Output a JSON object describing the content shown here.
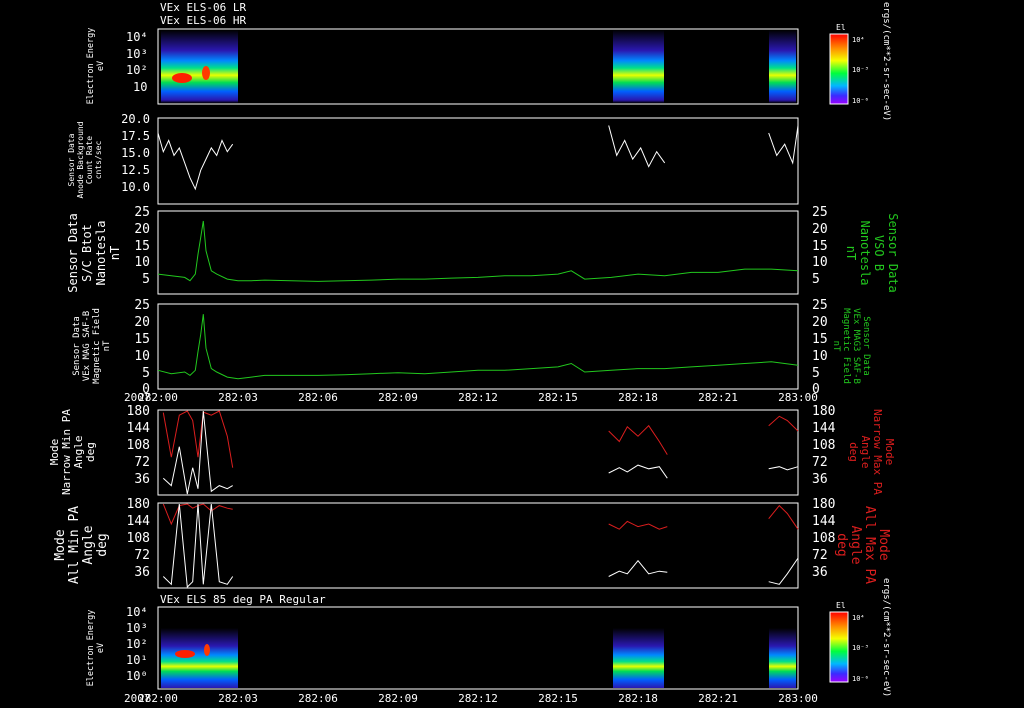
{
  "titles": {
    "top_line1": "VEx ELS-06 LR",
    "top_line2": "VEx ELS-06 HR",
    "bottom": "VEx ELS 85 deg PA Regular"
  },
  "colorbar": {
    "label": "El",
    "ticks": [
      "10⁴",
      "10⁻³",
      "10⁻⁶"
    ],
    "units": "ergs/(cm**2-sr-sec-eV)"
  },
  "time_axis": {
    "year": "2007",
    "ticks": [
      "282:00",
      "282:03",
      "282:06",
      "282:09",
      "282:12",
      "282:15",
      "282:18",
      "282:21",
      "283:00"
    ]
  },
  "colors": {
    "white_series": "#ffffff",
    "green_series": "#22c81e",
    "red_series": "#dc1e1e"
  },
  "chart_data": [
    {
      "type": "heatmap",
      "ylabel": [
        "Electron Energy",
        "eV"
      ],
      "yscale": "log",
      "ytick_labels": [
        "10⁴",
        "10³",
        "10²",
        "10"
      ],
      "data_intervals": [
        [
          "282:00",
          "282:02.9"
        ],
        [
          "282:16.9",
          "282:19.1"
        ],
        [
          "282:22.9",
          "282:24"
        ]
      ]
    },
    {
      "type": "line",
      "ylabel": [
        "Sensor Data",
        "Anode Background",
        "Count Rate",
        "cnts/sec"
      ],
      "ylim": [
        8.5,
        20
      ],
      "yticks": [
        "20.0",
        "17.5",
        "15.0",
        "12.5",
        "10.0"
      ],
      "series": [
        {
          "color": "#ffffff",
          "segment": 1,
          "x": [
            0,
            0.2,
            0.4,
            0.6,
            0.8,
            1.0,
            1.2,
            1.4,
            1.6,
            1.8,
            2.0,
            2.2,
            2.4,
            2.6,
            2.8
          ],
          "y": [
            18,
            15.5,
            17,
            15,
            16,
            14,
            12,
            10.5,
            13,
            14.5,
            16,
            15,
            17,
            15.5,
            16.5
          ]
        },
        {
          "color": "#ffffff",
          "segment": 2,
          "x": [
            16.9,
            17.2,
            17.5,
            17.8,
            18.1,
            18.4,
            18.7,
            19.0
          ],
          "y": [
            19,
            15,
            17,
            14.5,
            16,
            13.5,
            15.5,
            14
          ]
        },
        {
          "color": "#ffffff",
          "segment": 3,
          "x": [
            22.9,
            23.2,
            23.5,
            23.8,
            24.0
          ],
          "y": [
            18,
            15,
            16.5,
            14,
            19
          ]
        }
      ]
    },
    {
      "type": "line",
      "ylabel": [
        "Sensor Data",
        "S/C Btot",
        "Nanotesla",
        "nT"
      ],
      "ylabel_right": [
        "Sensor Data",
        "VSO B",
        "Nanotesla",
        "nT"
      ],
      "ylim": [
        0,
        25
      ],
      "yticks": [
        "25",
        "20",
        "15",
        "10",
        "5"
      ],
      "series": [
        {
          "color": "#22c81e",
          "x": [
            0,
            0.5,
            1.0,
            1.2,
            1.4,
            1.5,
            1.6,
            1.7,
            1.8,
            2.0,
            2.2,
            2.6,
            3.0,
            3.5,
            4,
            5,
            6,
            7,
            8,
            9,
            10,
            11,
            12,
            13,
            14,
            15,
            15.5,
            16,
            17,
            18,
            19,
            20,
            21,
            22,
            23,
            24
          ],
          "y": [
            6,
            5.5,
            5,
            4,
            6,
            12,
            17,
            22,
            13,
            7,
            6,
            4.5,
            4,
            4,
            4.2,
            4,
            3.8,
            4,
            4.2,
            4.5,
            4.5,
            4.8,
            5,
            5.5,
            5.5,
            6,
            7,
            4.5,
            5,
            6,
            5.5,
            6.5,
            6.5,
            7.5,
            7.5,
            7
          ]
        }
      ]
    },
    {
      "type": "line",
      "ylabel": [
        "Sensor Data",
        "VEx MAG SAF-B",
        "Magnetic Field",
        "nT"
      ],
      "ylabel_right": [
        "Sensor Data",
        "VEx MAG3 SAF-B",
        "Magnetic Field",
        "nT"
      ],
      "ylim": [
        0,
        25
      ],
      "yticks": [
        "25",
        "20",
        "15",
        "10",
        "5",
        "0"
      ],
      "series": [
        {
          "color": "#22c81e",
          "x": [
            0,
            0.5,
            1.0,
            1.2,
            1.4,
            1.5,
            1.6,
            1.7,
            1.8,
            2.0,
            2.2,
            2.6,
            3.0,
            3.5,
            4,
            5,
            6,
            7,
            8,
            9,
            10,
            11,
            12,
            13,
            14,
            15,
            15.5,
            16,
            17,
            18,
            19,
            20,
            21,
            22,
            23,
            24
          ],
          "y": [
            5.5,
            4.5,
            5,
            4,
            5.5,
            11,
            16,
            22,
            12,
            6,
            5,
            3.5,
            3,
            3.5,
            4,
            4,
            4,
            4.2,
            4.5,
            4.8,
            4.5,
            5,
            5.5,
            5.5,
            6,
            6.5,
            7.5,
            5,
            5.5,
            6,
            6,
            6.5,
            7,
            7.5,
            8,
            7
          ]
        }
      ]
    },
    {
      "type": "line",
      "ylabel": [
        "Mode",
        "Narrow Min PA",
        "Angle",
        "deg"
      ],
      "ylabel_right": [
        "Mode",
        "Narrow Max PA",
        "Angle",
        "deg"
      ],
      "ylim": [
        18,
        180
      ],
      "yticks": [
        "180",
        "144",
        "108",
        "72",
        "36"
      ],
      "series": [
        {
          "color": "#dc1e1e",
          "x": [
            0.2,
            0.5,
            0.8,
            1.1,
            1.3,
            1.5,
            1.7,
            2.0,
            2.3,
            2.6,
            2.8
          ],
          "y": [
            175,
            90,
            170,
            178,
            160,
            90,
            176,
            170,
            178,
            130,
            70
          ]
        },
        {
          "color": "#dc1e1e",
          "x": [
            16.9,
            17.3,
            17.6,
            18.0,
            18.4,
            18.8,
            19.1
          ],
          "y": [
            140,
            120,
            148,
            130,
            150,
            120,
            95
          ]
        },
        {
          "color": "#dc1e1e",
          "x": [
            22.9,
            23.3,
            23.6,
            24.0
          ],
          "y": [
            150,
            168,
            160,
            140
          ]
        },
        {
          "color": "#ffffff",
          "x": [
            0.2,
            0.5,
            0.8,
            1.1,
            1.3,
            1.5,
            1.7,
            2.0,
            2.3,
            2.6,
            2.8
          ],
          "y": [
            50,
            36,
            110,
            20,
            70,
            30,
            178,
            25,
            36,
            30,
            36
          ]
        },
        {
          "color": "#ffffff",
          "x": [
            16.9,
            17.3,
            17.6,
            18.0,
            18.4,
            18.8,
            19.1
          ],
          "y": [
            60,
            70,
            62,
            75,
            68,
            72,
            50
          ]
        },
        {
          "color": "#ffffff",
          "x": [
            22.9,
            23.3,
            23.6,
            24.0
          ],
          "y": [
            68,
            72,
            66,
            72
          ]
        }
      ]
    },
    {
      "type": "line",
      "ylabel": [
        "Mode",
        "All Min PA",
        "Angle",
        "deg"
      ],
      "ylabel_right": [
        "Mode",
        "All Max PA",
        "Angle",
        "deg"
      ],
      "ylim": [
        18,
        180
      ],
      "yticks": [
        "180",
        "144",
        "108",
        "72",
        "36"
      ],
      "series": [
        {
          "color": "#dc1e1e",
          "x": [
            0.2,
            0.5,
            0.8,
            1.1,
            1.3,
            1.5,
            1.7,
            2.0,
            2.3,
            2.6,
            2.8
          ],
          "y": [
            178,
            140,
            175,
            178,
            170,
            175,
            178,
            165,
            175,
            170,
            168
          ]
        },
        {
          "color": "#dc1e1e",
          "x": [
            16.9,
            17.3,
            17.6,
            18.0,
            18.4,
            18.8,
            19.1
          ],
          "y": [
            140,
            130,
            145,
            135,
            140,
            130,
            135
          ]
        },
        {
          "color": "#dc1e1e",
          "x": [
            22.9,
            23.3,
            23.6,
            24.0
          ],
          "y": [
            150,
            175,
            160,
            130
          ]
        },
        {
          "color": "#ffffff",
          "x": [
            0.2,
            0.5,
            0.8,
            1.1,
            1.3,
            1.5,
            1.7,
            2.0,
            2.3,
            2.6,
            2.8
          ],
          "y": [
            40,
            25,
            178,
            20,
            30,
            178,
            25,
            178,
            30,
            25,
            40
          ]
        },
        {
          "color": "#ffffff",
          "x": [
            16.9,
            17.3,
            17.6,
            18.0,
            18.4,
            18.8,
            19.1
          ],
          "y": [
            40,
            50,
            45,
            70,
            45,
            50,
            48
          ]
        },
        {
          "color": "#ffffff",
          "x": [
            22.9,
            23.3,
            23.6,
            24.0
          ],
          "y": [
            30,
            25,
            45,
            75
          ]
        }
      ]
    },
    {
      "type": "heatmap",
      "ylabel": [
        "Electron Energy",
        "eV"
      ],
      "yscale": "log",
      "ytick_labels": [
        "10⁴",
        "10³",
        "10²",
        "10¹",
        "10⁰"
      ],
      "data_intervals": [
        [
          "282:00",
          "282:02.9"
        ],
        [
          "282:16.9",
          "282:19.1"
        ],
        [
          "282:22.9",
          "282:24"
        ]
      ]
    }
  ]
}
